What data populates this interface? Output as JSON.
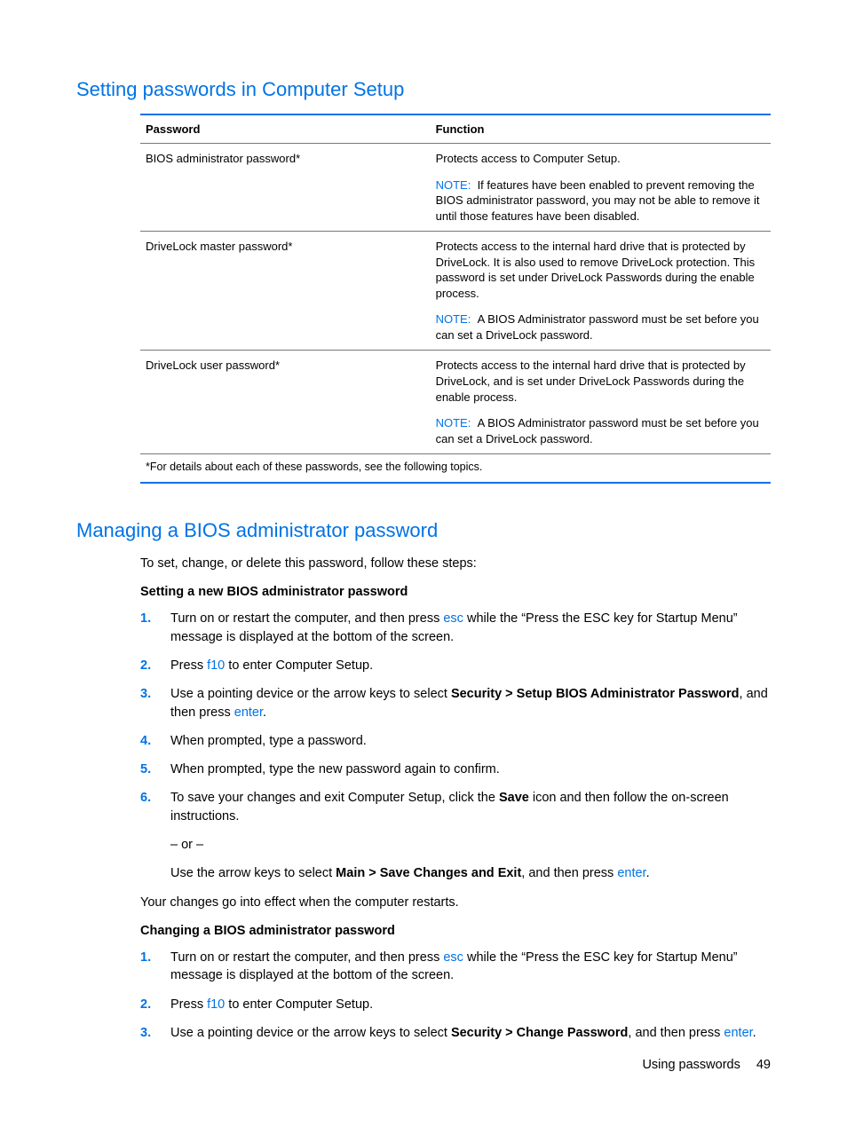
{
  "section1": {
    "heading": "Setting passwords in Computer Setup",
    "table": {
      "headers": {
        "password": "Password",
        "function": "Function"
      },
      "rows": [
        {
          "password": "BIOS administrator password*",
          "function_main": "Protects access to Computer Setup.",
          "note_label": "NOTE:",
          "note_text": "If features have been enabled to prevent removing the BIOS administrator password, you may not be able to remove it until those features have been disabled."
        },
        {
          "password": "DriveLock master password*",
          "function_main": "Protects access to the internal hard drive that is protected by DriveLock. It is also used to remove DriveLock protection. This password is set under DriveLock Passwords during the enable process.",
          "note_label": "NOTE:",
          "note_text": "A BIOS Administrator password must be set before you can set a DriveLock password."
        },
        {
          "password": "DriveLock user password*",
          "function_main": "Protects access to the internal hard drive that is protected by DriveLock, and is set under DriveLock Passwords during the enable process.",
          "note_label": "NOTE:",
          "note_text": "A BIOS Administrator password must be set before you can set a DriveLock password."
        }
      ],
      "footnote": "*For details about each of these passwords, see the following topics."
    }
  },
  "section2": {
    "heading": "Managing a BIOS administrator password",
    "intro": "To set, change, or delete this password, follow these steps:",
    "subA": {
      "heading": "Setting a new BIOS administrator password",
      "steps": [
        {
          "n": "1.",
          "pre": "Turn on or restart the computer, and then press ",
          "key": "esc",
          "post": " while the “Press the ESC key for Startup Menu” message is displayed at the bottom of the screen."
        },
        {
          "n": "2.",
          "pre": "Press ",
          "key": "f10",
          "post": " to enter Computer Setup."
        },
        {
          "n": "3.",
          "pre": "Use a pointing device or the arrow keys to select ",
          "bold": "Security > Setup BIOS Administrator Password",
          "mid": ", and then press ",
          "key2": "enter",
          "post2": "."
        },
        {
          "n": "4.",
          "pre": "When prompted, type a password."
        },
        {
          "n": "5.",
          "pre": "When prompted, type the new password again to confirm."
        },
        {
          "n": "6.",
          "pre": "To save your changes and exit Computer Setup, click the ",
          "bold": "Save",
          "post": " icon and then follow the on-screen instructions.",
          "or": "– or –",
          "alt_pre": "Use the arrow keys to select ",
          "alt_bold": "Main > Save Changes and Exit",
          "alt_mid": ", and then press ",
          "alt_key": "enter",
          "alt_post": "."
        }
      ],
      "outro": "Your changes go into effect when the computer restarts."
    },
    "subB": {
      "heading": "Changing a BIOS administrator password",
      "steps": [
        {
          "n": "1.",
          "pre": "Turn on or restart the computer, and then press ",
          "key": "esc",
          "post": " while the “Press the ESC key for Startup Menu” message is displayed at the bottom of the screen."
        },
        {
          "n": "2.",
          "pre": "Press ",
          "key": "f10",
          "post": " to enter Computer Setup."
        },
        {
          "n": "3.",
          "pre": "Use a pointing device or the arrow keys to select ",
          "bold": "Security > Change Password",
          "mid": ", and then press ",
          "key2": "enter",
          "post2": "."
        }
      ]
    }
  },
  "footer": {
    "label": "Using passwords",
    "page": "49"
  }
}
